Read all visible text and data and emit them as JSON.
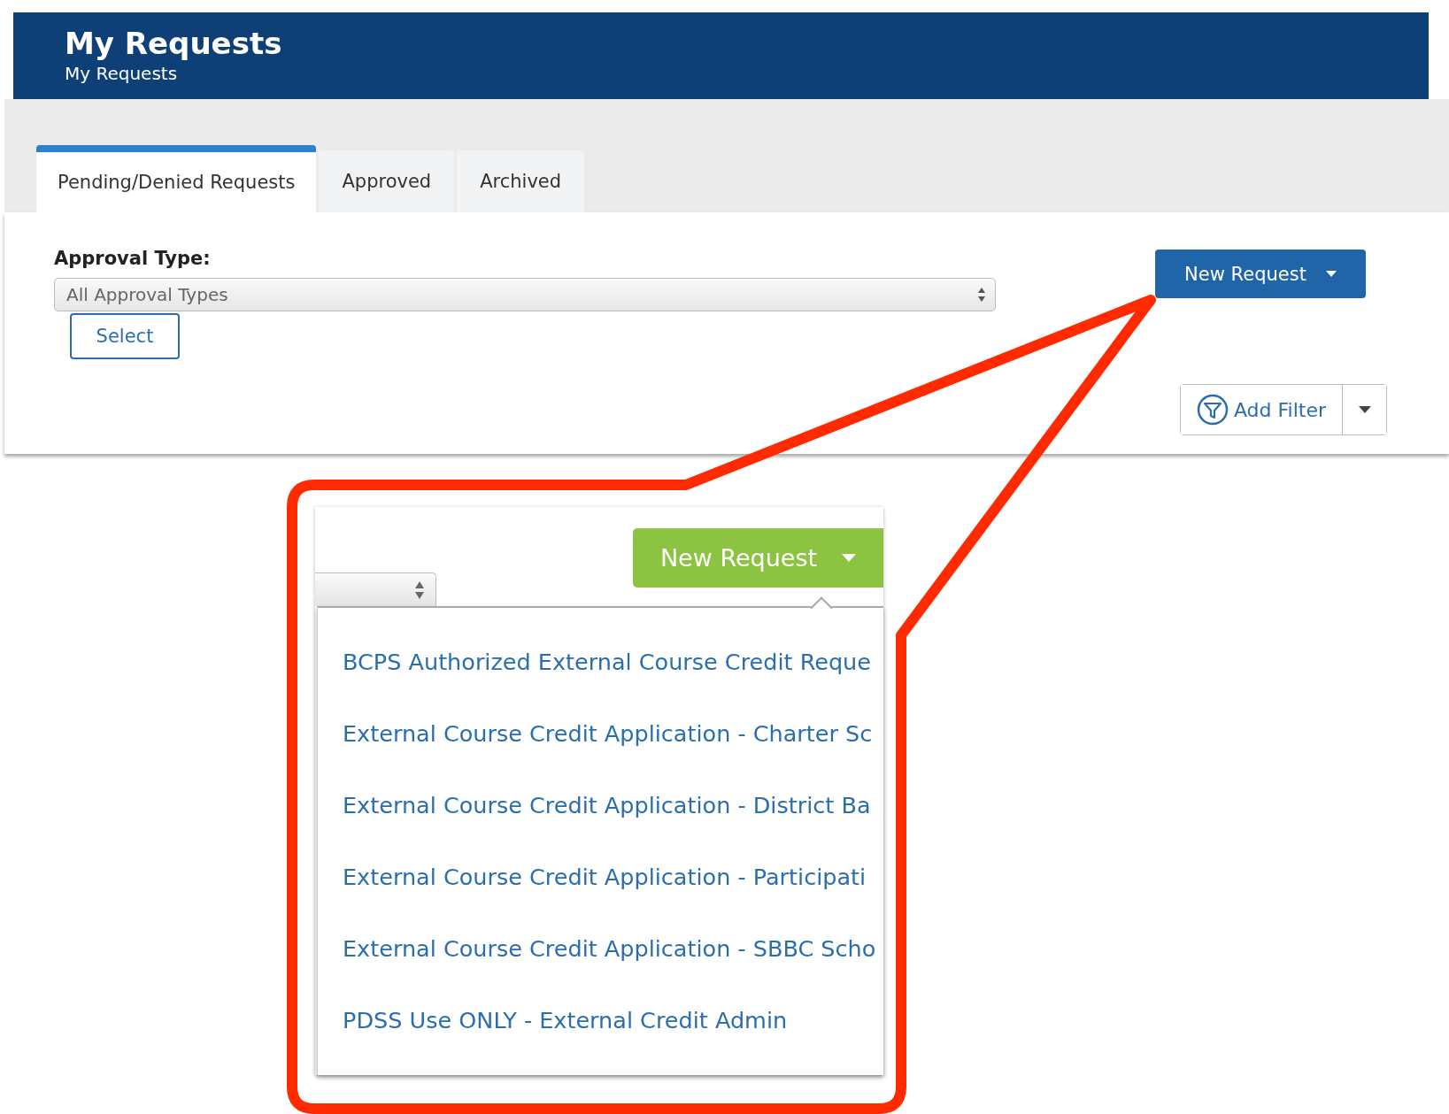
{
  "header": {
    "title": "My Requests",
    "subtitle": "My Requests"
  },
  "tabs": [
    {
      "label": "Pending/Denied Requests",
      "selected": true
    },
    {
      "label": "Approved",
      "selected": false
    },
    {
      "label": "Archived",
      "selected": false
    }
  ],
  "filter": {
    "label": "Approval Type:",
    "value": "All Approval Types",
    "button": "Select"
  },
  "new_request_button": "New Request",
  "add_filter_button": "Add Filter",
  "callout": {
    "button": "New Request",
    "menu_items": [
      "BCPS Authorized External Course Credit Reque",
      "External Course Credit Application - Charter Sc",
      "External Course Credit Application - District Ba",
      "External Course Credit Application - Participati",
      "External Course Credit Application - SBBC Scho",
      "PDSS Use ONLY - External Credit Admin"
    ]
  }
}
